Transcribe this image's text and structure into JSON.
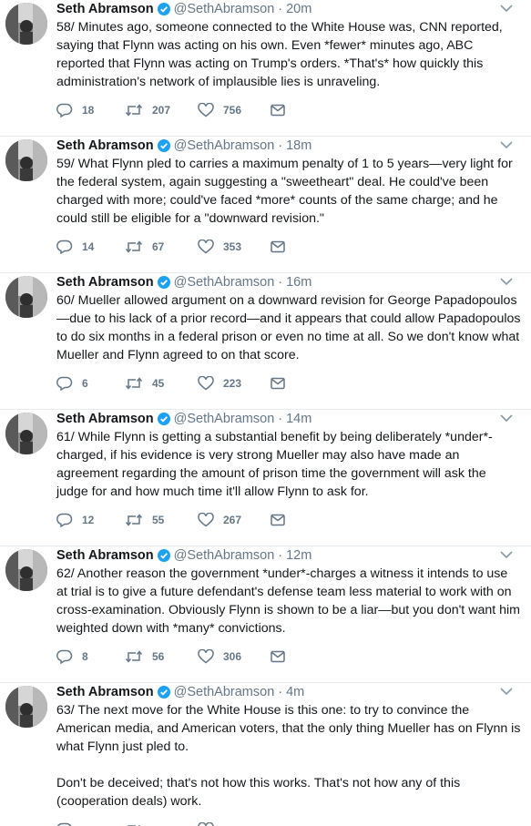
{
  "tweets": [
    {
      "name": "Seth Abramson",
      "handle": "@SethAbramson",
      "time": "20m",
      "text": "58/ Minutes ago, someone connected to the White House was, CNN reported, saying that Flynn was acting on his own. Even *fewer* minutes ago, ABC reported that Flynn was acting on Trump's orders. *That's* how quickly this administration's network of implausible lies is unraveling.",
      "replies": "18",
      "retweets": "207",
      "likes": "756"
    },
    {
      "name": "Seth Abramson",
      "handle": "@SethAbramson",
      "time": "18m",
      "text": "59/ What Flynn pled to carries a maximum penalty of 1 to 5 years—very light for the federal system, again suggesting a \"sweetheart\" deal. He could've been charged with more; could've faced *more* counts of the same charge; and he could still be eligible for a \"downward revision.\"",
      "replies": "14",
      "retweets": "67",
      "likes": "353"
    },
    {
      "name": "Seth Abramson",
      "handle": "@SethAbramson",
      "time": "16m",
      "text": "60/ Mueller allowed argument on a downward revision for George Papadopoulos—due to his lack of a prior record—and it appears that could allow Papadopoulos to do six months in a federal prison or even no time at all. So we don't know what Mueller and Flynn agreed to on that score.",
      "replies": "6",
      "retweets": "45",
      "likes": "223"
    },
    {
      "name": "Seth Abramson",
      "handle": "@SethAbramson",
      "time": "14m",
      "text": "61/ While Flynn is getting a substantial benefit by being deliberately *under*-charged, if his evidence is very strong Mueller may also have made an agreement regarding the amount of prison time the government will ask the judge for and how much time it'll allow Flynn to ask for.",
      "replies": "12",
      "retweets": "55",
      "likes": "267"
    },
    {
      "name": "Seth Abramson",
      "handle": "@SethAbramson",
      "time": "12m",
      "text": "62/ Another reason the government *under*-charges a witness it intends to use at trial is to give a future defendant's defense team less material to work with on cross-examination. Obviously Flynn is shown to be a liar—but you don't want him weighted down with *many* convictions.",
      "replies": "8",
      "retweets": "56",
      "likes": "306"
    },
    {
      "name": "Seth Abramson",
      "handle": "@SethAbramson",
      "time": "4m",
      "text": "63/ The next move for the White House is this one: to try to convince the American media, and American voters, that the only thing Mueller has on Flynn is what Flynn just pled to.\n\nDon't be deceived; that's not how this works. That's not how any of this (cooperation deals) work.",
      "replies": "",
      "retweets": "",
      "likes": ""
    }
  ],
  "separator": "·",
  "icons": {
    "verified": "verified-badge-icon",
    "caret": "chevron-down-icon",
    "reply": "reply-icon",
    "retweet": "retweet-icon",
    "like": "heart-icon",
    "mail": "direct-message-icon",
    "avatar": "profile-avatar"
  },
  "colors": {
    "verified": "#1da1f2",
    "muted": "#657786",
    "text": "#14171a",
    "divider": "#e6ecf0"
  }
}
